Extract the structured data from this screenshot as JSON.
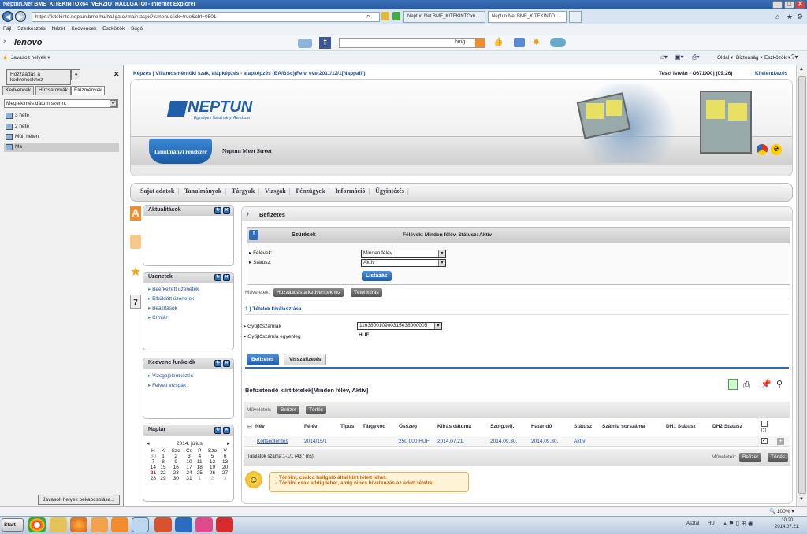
{
  "window": {
    "title": "Neptun.Net BME_KITEKINTOx64_VERZIO_HALLGATOI - Internet Explorer"
  },
  "browser": {
    "url": "https://kitekinto.neptun.bme.hu/hallgatoi/main.aspx?ismenuclick=true&ctrl=0501",
    "tabs": [
      {
        "label": "Neptun.Net BME_KITEKINTOx6..."
      },
      {
        "label": "Neptun.Net BME_KITEKINTO..."
      }
    ],
    "menu": [
      "Fájl",
      "Szerkesztés",
      "Nézet",
      "Kedvencek",
      "Eszközök",
      "Súgó"
    ],
    "lenovo": "lenovo",
    "bing_label": "bing",
    "fav_suggested": "Javasolt helyek ▾",
    "cmdbar": [
      "Oldal ▾",
      "Biztonság ▾",
      "Eszközök ▾"
    ]
  },
  "leftpane": {
    "add_fav": "Hozzáadás a kedvencekhez",
    "tabs": [
      "Kedvencek",
      "Hírcsatornák",
      "Előzmények"
    ],
    "sort": "Megtekintés dátum szerint",
    "items": [
      "3 hete",
      "2 hete",
      "Múlt héten",
      "Ma"
    ],
    "bottom_btn": "Javasolt helyek bekapcsolása..."
  },
  "topline": {
    "crumb": "Képzés | Villamosmérnöki szak, alapképzés - alapképzés (BA/BSc)(Felv. éve:2011/12/1[Nappali])",
    "user": "Teszt István - O671XX | (09:26)",
    "logout": "Kijelentkezés"
  },
  "header": {
    "logo": "NEPTUN",
    "logo_sub": "Egységes Tanulmányi Rendszer",
    "tab_active": "Tanulmányi rendszer",
    "meet": "Neptun Meet Street"
  },
  "mainmenu": [
    "Saját adatok",
    "Tanulmányok",
    "Tárgyak",
    "Vizsgák",
    "Pénzügyek",
    "Információ",
    "Ügyintézés"
  ],
  "boxes": {
    "aktualitasok": "Aktualitások",
    "uzenetek": {
      "title": "Üzenetek",
      "items": [
        "Beérkezett üzenetek",
        "Elküldött üzenetek",
        "Beállítások",
        "Címtár"
      ]
    },
    "kedvenc": {
      "title": "Kedvenc funkciók",
      "items": [
        "Vizsgajelentkezés",
        "Felvett vizsgák"
      ]
    },
    "naptar": {
      "title": "Naptár",
      "month": "2014. július",
      "days": [
        "H",
        "K",
        "Sze",
        "Cs",
        "P",
        "Szo",
        "V"
      ],
      "weeks": [
        [
          "30",
          "1",
          "2",
          "3",
          "4",
          "5",
          "6"
        ],
        [
          "7",
          "8",
          "9",
          "10",
          "11",
          "12",
          "13"
        ],
        [
          "14",
          "15",
          "16",
          "17",
          "18",
          "19",
          "20"
        ],
        [
          "21",
          "22",
          "23",
          "24",
          "25",
          "26",
          "27"
        ],
        [
          "28",
          "29",
          "30",
          "31",
          "1",
          "2",
          "3"
        ]
      ]
    }
  },
  "page": {
    "title": "Befizetés",
    "filters_title": "Szűrések",
    "filters_summary": "Félévek: Minden félév, Státusz: Aktív",
    "felevek_label": "Félévek:",
    "felevek_value": "Minden félév",
    "statusz_label": "Státusz:",
    "statusz_value": "Aktív",
    "listazas": "Listázás",
    "muveletek": "Műveletek:",
    "add_fav": "Hozzáadás a kedvencekhez",
    "tetel_kiiras": "Tétel kiírás",
    "section1": "1.) Tételek kiválasztása",
    "gyujto_label": "Gyűjtőszámlák",
    "gyujto_value": "11638001090031503800000​5",
    "egyenleg_label": "Gyűjtőszámla egyenleg",
    "egyenleg_value": "HUF",
    "tabs": [
      "Befizetés",
      "Visszafizetés"
    ],
    "table_title": "Befizetendő kiírt tételek[Minden félév, Aktív]",
    "btn_befizet": "Befizet",
    "btn_torles": "Törlés",
    "columns": [
      "Név",
      "Félév",
      "Típus",
      "Tárgykód",
      "Összeg",
      "Kiírás dátuma",
      "Szolg.telj.",
      "Határidő",
      "Státusz",
      "Számla sorszáma",
      "DH1 Státusz",
      "DH2 Státusz"
    ],
    "row": {
      "nev": "Költségtérítés",
      "felev": "2014/15/1",
      "osszeg": "250 000 HUF",
      "kiiras": "2014.07.21.",
      "szolg": "2014.09.30.",
      "hatarido": "2014.09.30.",
      "statusz": "Aktív"
    },
    "count_box": "[1]",
    "found": "Találatok száma:1-1/1 (437 ms)",
    "notes": [
      "- Törölni, csak a hallgató által kiírt tételt lehet.",
      "- Törölni csak addig lehet, amíg nincs hivatkozás az adott tételre!"
    ]
  },
  "status": {
    "zoom": "100%"
  },
  "taskbar": {
    "start": "Start",
    "desktop": "Asztal",
    "lang": "HU",
    "time": "10:20",
    "date": "2014.07.21."
  },
  "colors": {
    "accent": "#2e6db5",
    "link": "#1c4e9c"
  }
}
